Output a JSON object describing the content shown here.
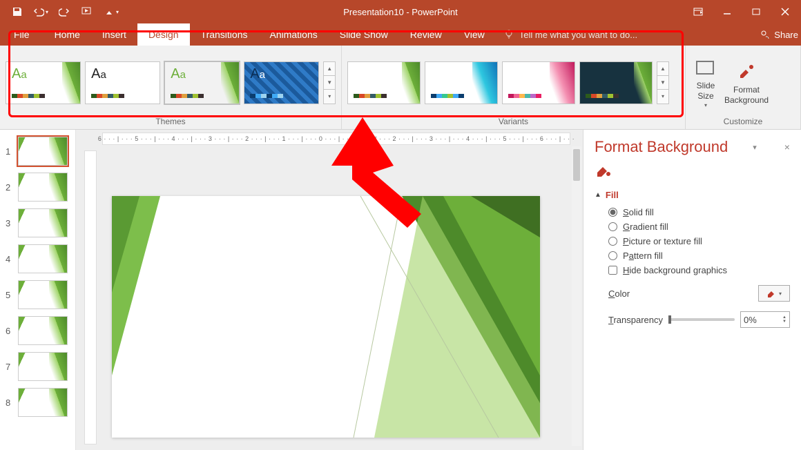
{
  "titlebar": {
    "title": "Presentation10 - PowerPoint"
  },
  "tabs": {
    "file": "File",
    "home": "Home",
    "insert": "Insert",
    "design": "Design",
    "transitions": "Transitions",
    "animations": "Animations",
    "slideshow": "Slide Show",
    "review": "Review",
    "view": "View",
    "tellme_placeholder": "Tell me what you want to do...",
    "share": "Share"
  },
  "ribbon": {
    "themes_label": "Themes",
    "variants_label": "Variants",
    "customize_label": "Customize",
    "slide_size": "Slide\nSize",
    "format_bg": "Format\nBackground",
    "themes": [
      {
        "aa_color": "#6DAF3A",
        "accent": "green"
      },
      {
        "aa_color": "#222222",
        "accent": "green"
      },
      {
        "aa_color": "#6DAF3A",
        "accent": "green",
        "selected": true
      },
      {
        "aa_color": "#1F3E63",
        "accent": "blue_pattern"
      }
    ]
  },
  "ruler": "6 · · · | · · · 5 · · · | · · · 4 · · · | · · · 3 · · · | · · · 2 · · · | · · · 1 · · · | · · · 0 · · · | · · · 1 · · · | · · · 2 · · · | · · · 3 · · · | · · · 4 · · · | · · · 5 · · · | · · · 6 · · · | · · ·",
  "slides": [
    1,
    2,
    3,
    4,
    5,
    6,
    7,
    8
  ],
  "pane": {
    "title": "Format Background",
    "fill_header": "Fill",
    "solid": "Solid fill",
    "gradient": "Gradient fill",
    "picture": "Picture or texture fill",
    "pattern": "Pattern fill",
    "hide": "Hide background graphics",
    "color_label": "Color",
    "transparency_label": "Transparency",
    "transparency_value": "0%"
  }
}
